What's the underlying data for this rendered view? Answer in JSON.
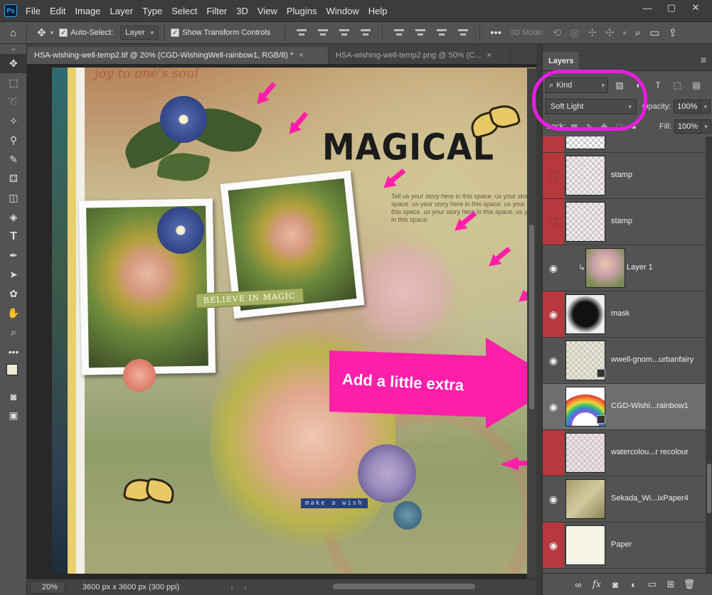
{
  "app": {
    "logo": "Ps"
  },
  "menu": [
    "File",
    "Edit",
    "Image",
    "Layer",
    "Type",
    "Select",
    "Filter",
    "3D",
    "View",
    "Plugins",
    "Window",
    "Help"
  ],
  "window_controls": {
    "minimize": "—",
    "maximize": "▢",
    "close": "✕"
  },
  "options_bar": {
    "auto_select_label": "Auto-Select:",
    "auto_select_target": "Layer",
    "show_transform_label": "Show Transform Controls",
    "mode_3d_label": "3D Mode:"
  },
  "tabs": [
    {
      "label": "HSA-wishing-well-temp2.tif @ 20% (CGD-WishingWell-rainbow1, RGB/8) *",
      "close": "×"
    },
    {
      "label": "HSA-wishing-well-temp2.png @ 50% (C...",
      "close": "×"
    }
  ],
  "artwork": {
    "top_script": "joy to one's soul",
    "title": "MAGICAL",
    "story_text": "Tell us your story here in this space. us your story here in this space. us your story here in this space. us your story here in this space. us your story here in this space. us your story here in this space.",
    "believe_tag": "BELIEVE IN MAGIC",
    "make_tag": "make a wish"
  },
  "annotation": {
    "callout_text": "Add a little extra",
    "color": "#ff1fa8",
    "ring_color": "#e81ee0"
  },
  "status": {
    "zoom": "20%",
    "doc_size": "3600 px x 3600 px (300 ppi)"
  },
  "layers_panel": {
    "tab_label": "Layers",
    "kind_label": "Kind",
    "blend_mode": "Soft Light",
    "opacity_label": "Opacity:",
    "opacity_value": "100%",
    "lock_label": "Lock:",
    "fill_label": "Fill:",
    "fill_value": "100%",
    "layers": [
      {
        "name": "",
        "visible": false,
        "red": true
      },
      {
        "name": "stamp",
        "visible": false,
        "red": true
      },
      {
        "name": "stamp",
        "visible": false,
        "red": true
      },
      {
        "name": "Layer 1",
        "visible": true,
        "red": false,
        "clipped": true
      },
      {
        "name": "mask",
        "visible": true,
        "red": true
      },
      {
        "name": "wwell-gnom...urbanfairy",
        "visible": true,
        "red": false,
        "smart": true
      },
      {
        "name": "CGD-Wishi...rainbow1",
        "visible": true,
        "red": false,
        "smart": true,
        "selected": true
      },
      {
        "name": "watercolou...r recolour",
        "visible": false,
        "red": true
      },
      {
        "name": "Sekada_Wi...ixPaper4",
        "visible": true,
        "red": false
      },
      {
        "name": "Paper",
        "visible": true,
        "red": true
      }
    ],
    "footer_icons": [
      "link-icon",
      "fx-icon",
      "mask-icon",
      "adjustment-icon",
      "folder-icon",
      "new-layer-icon",
      "trash-icon"
    ]
  }
}
